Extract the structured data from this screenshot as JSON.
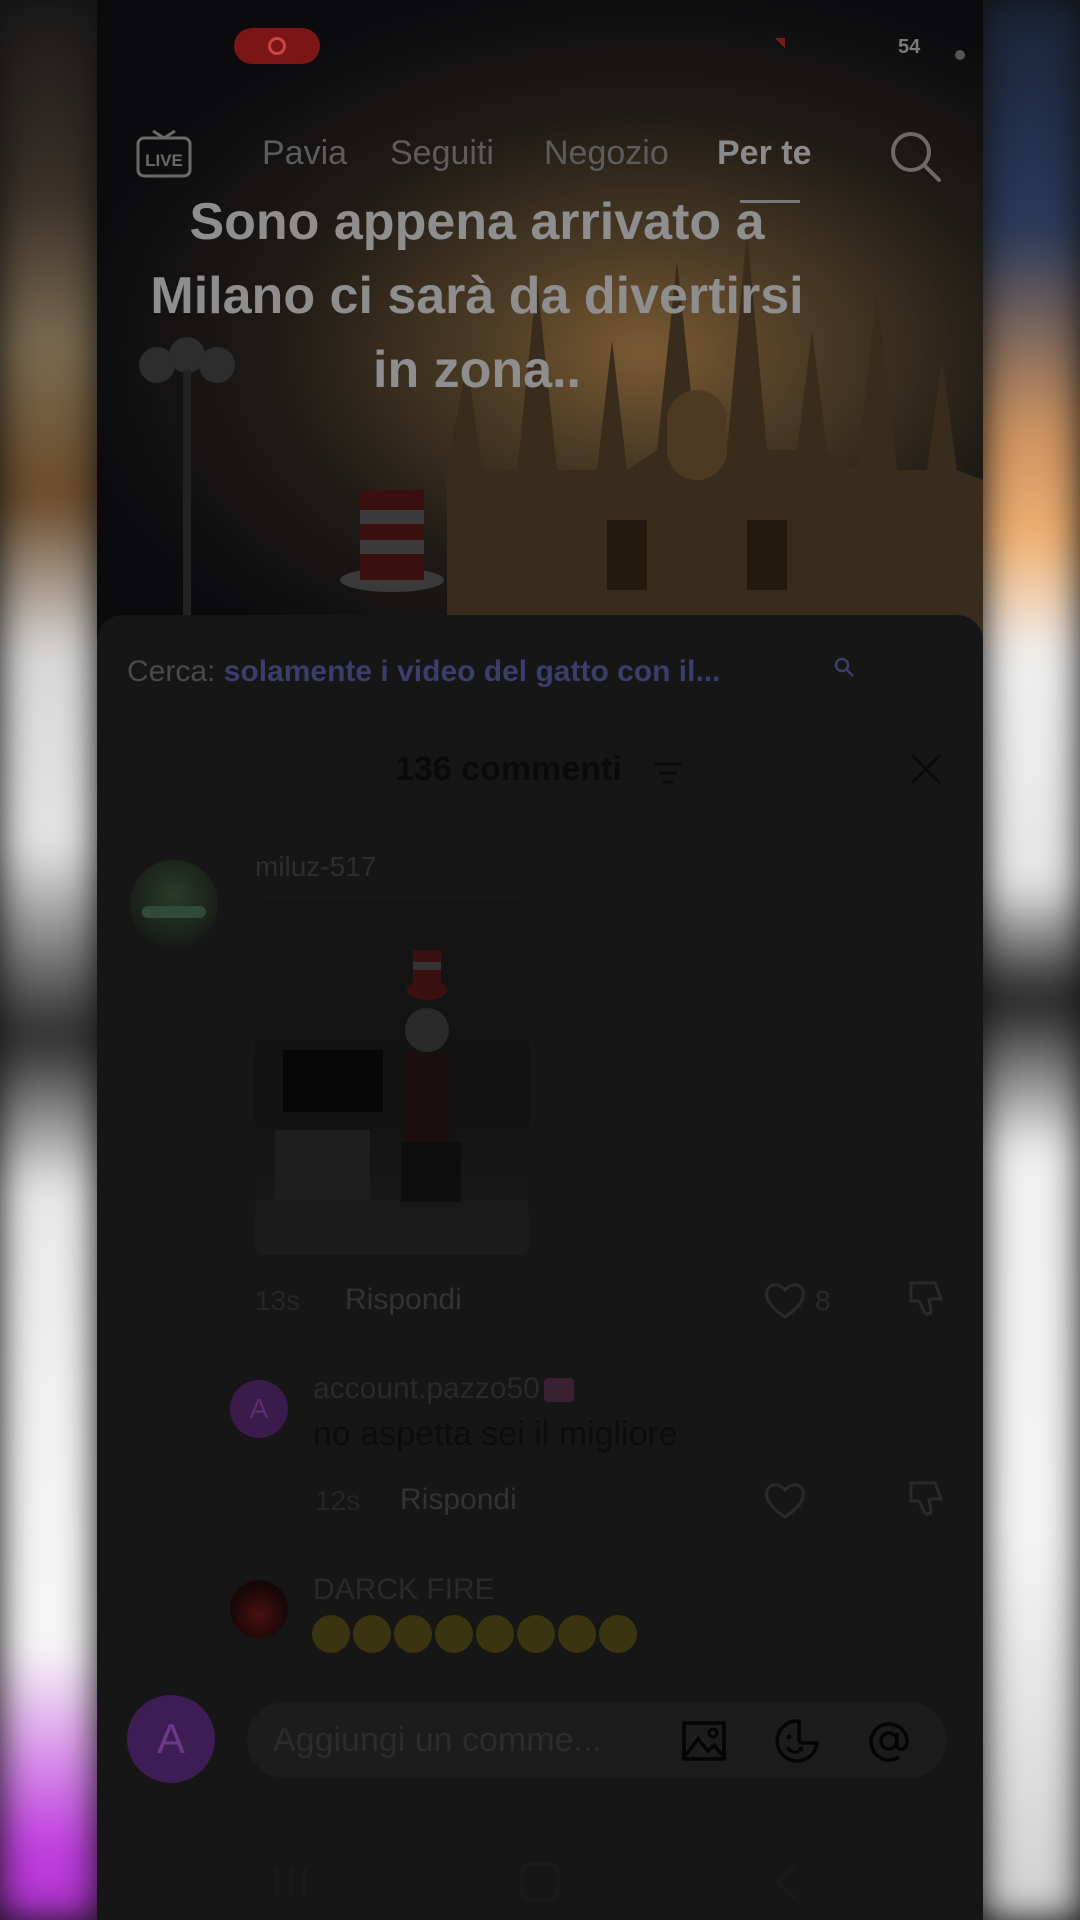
{
  "status_bar": {
    "battery": "54"
  },
  "top_nav": {
    "live_label": "LIVE",
    "tabs": [
      {
        "label": "Pavia",
        "active": false
      },
      {
        "label": "Seguiti",
        "active": false
      },
      {
        "label": "Negozio",
        "active": false
      },
      {
        "label": "Per te",
        "active": true
      }
    ]
  },
  "video": {
    "caption_lines": [
      "Sono appena arrivato a",
      "Milano ci sarà da divertirsi",
      "in zona.."
    ]
  },
  "comments_sheet": {
    "search_hint_label": "Cerca:",
    "search_hint_query": "solamente i video del gatto con il...",
    "count_label": "136 commenti",
    "comments": [
      {
        "username": "miluz-517",
        "time": "13s",
        "reply_label": "Rispondi",
        "likes": "8"
      }
    ],
    "replies": [
      {
        "avatar_letter": "A",
        "username": "account.pazzo50",
        "text": "no aspetta sei il migliore",
        "time": "12s",
        "reply_label": "Rispondi"
      },
      {
        "username": "DARCK FIRE",
        "emoji_count": 8
      }
    ]
  },
  "input_bar": {
    "avatar_letter": "A",
    "placeholder": "Aggiungi un comme..."
  },
  "colors": {
    "sheet_bg": "#161616",
    "accent_query": "#3b3d6a",
    "avatar_purple": "#3e1c54"
  },
  "icons": [
    "live-icon",
    "search-icon",
    "filter-icon",
    "close-icon",
    "heart-icon",
    "dislike-icon",
    "image-icon",
    "sticker-icon",
    "mention-icon",
    "recents-icon",
    "home-icon",
    "back-icon"
  ]
}
